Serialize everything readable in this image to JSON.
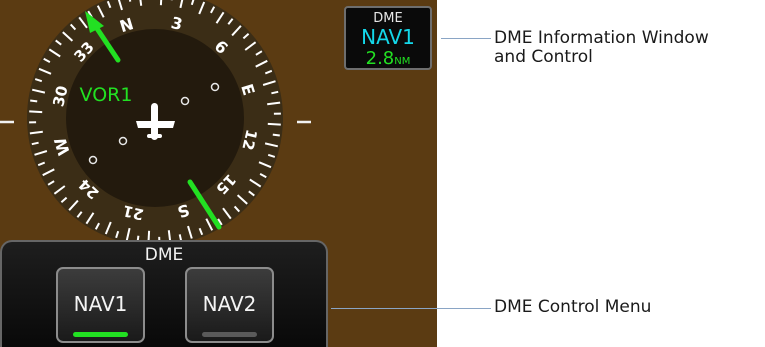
{
  "hsi": {
    "heading_labels": [
      "N",
      "3",
      "6",
      "E",
      "12",
      "15",
      "S",
      "21",
      "24",
      "W",
      "30",
      "33"
    ],
    "bearing_pointer_label": "VOR1",
    "colors": {
      "terrain": "#5b3b12",
      "compass": "#3b2d16",
      "inner": "#231a0d",
      "needle": "#22e022",
      "bearing_text": "#22e022"
    }
  },
  "dme_window": {
    "title": "DME",
    "source": "NAV1",
    "distance": "2.8",
    "unit": "NM"
  },
  "dme_menu": {
    "title": "DME",
    "buttons": [
      {
        "label": "NAV1",
        "selected": true
      },
      {
        "label": "NAV2",
        "selected": false
      }
    ]
  },
  "callouts": {
    "info_window": [
      "DME Information Window",
      "and Control"
    ],
    "control_menu": "DME Control Menu"
  }
}
